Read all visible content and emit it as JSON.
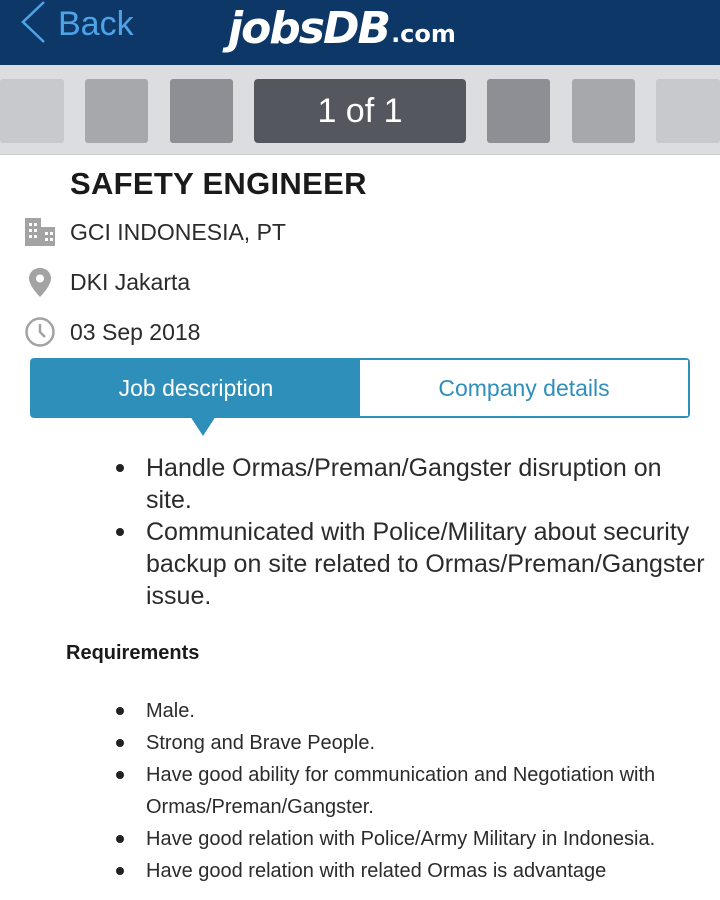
{
  "header": {
    "back_label": "Back",
    "logo_main": "jobsDB",
    "logo_suffix": ".com"
  },
  "pager": {
    "counter": "1 of 1"
  },
  "job": {
    "title": "SAFETY ENGINEER",
    "company": "GCI INDONESIA, PT",
    "location": "DKI Jakarta",
    "date": "03 Sep 2018"
  },
  "tabs": {
    "active": "Job description",
    "inactive": "Company details"
  },
  "description": {
    "items": [
      "Handle Ormas/Preman/Gangster disruption on site.",
      "Communicated with Police/Military about security backup on site related to Ormas/Preman/Gangster issue."
    ]
  },
  "requirements": {
    "heading": "Requirements",
    "items": [
      "Male.",
      "Strong and Brave People.",
      "Have good ability for communication and Negotiation with Ormas/Preman/Gangster.",
      "Have good relation with Police/Army Military in Indonesia.",
      "Have good relation with related Ormas is advantage"
    ]
  },
  "icons": {
    "back": "chevron-left-icon",
    "company": "building-icon",
    "location": "map-pin-icon",
    "date": "clock-icon"
  },
  "colors": {
    "header_bg": "#0d3766",
    "accent": "#2f8fbb",
    "back_link": "#4ea3e8",
    "counter_bg": "#55575f"
  }
}
